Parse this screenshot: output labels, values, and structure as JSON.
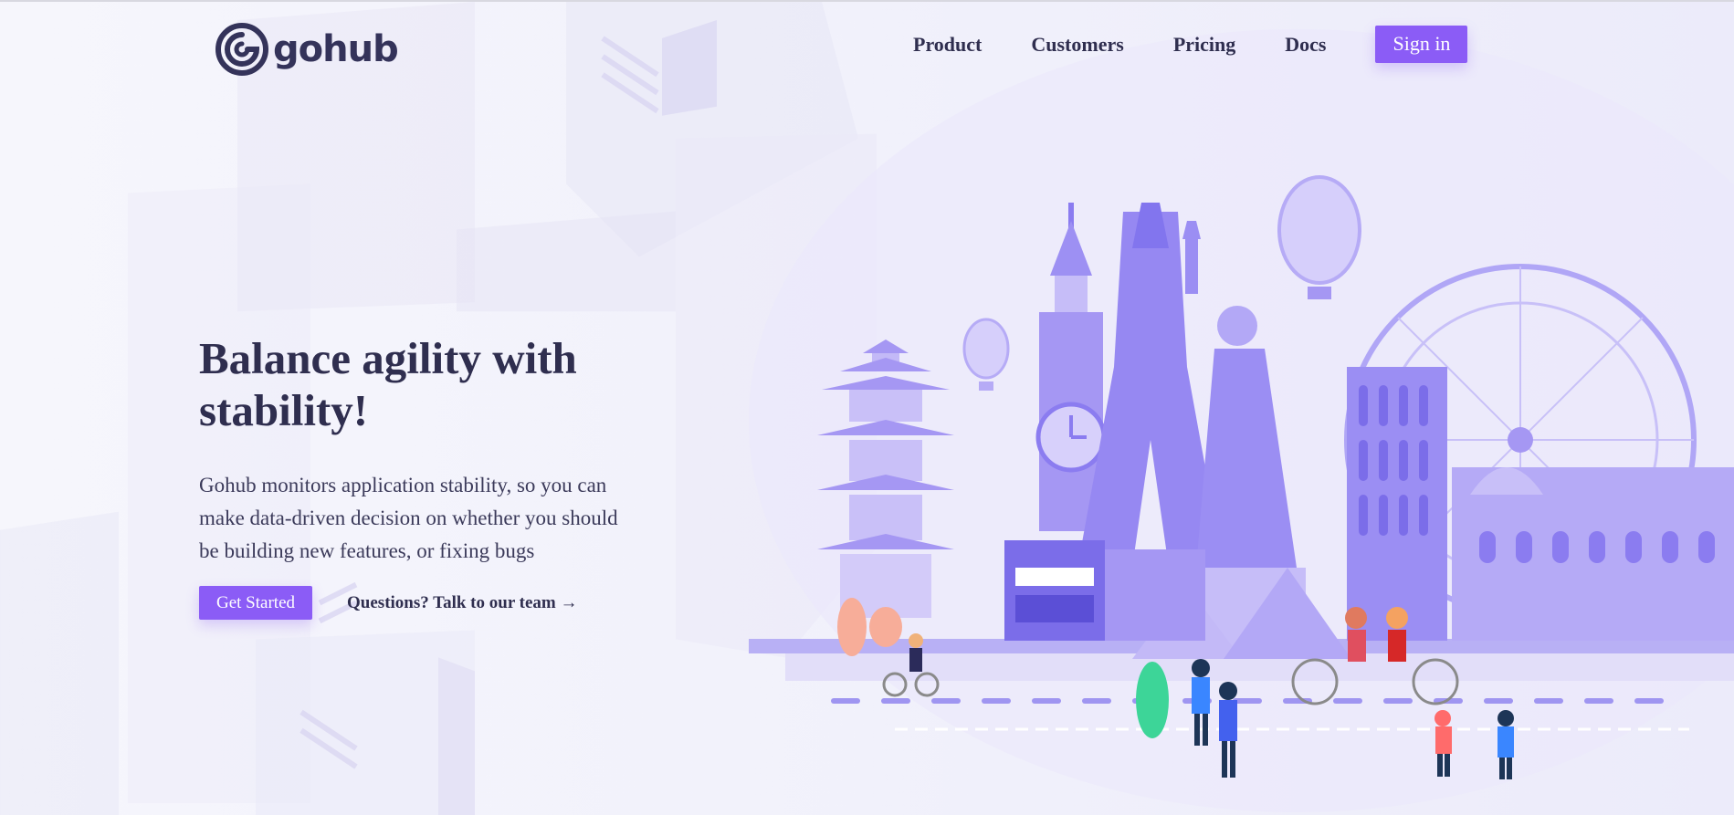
{
  "brand": {
    "name": "gohub"
  },
  "nav": {
    "items": [
      {
        "label": "Product"
      },
      {
        "label": "Customers"
      },
      {
        "label": "Pricing"
      },
      {
        "label": "Docs"
      }
    ],
    "sign_in_label": "Sign in"
  },
  "hero": {
    "title_line1": "Balance agility with",
    "title_line2": "stability!",
    "description": "Gohub monitors application stability, so you can make data-driven decision on whether you should be building new features, or fixing bugs",
    "primary_cta": "Get Started",
    "secondary_cta": "Questions? Talk to our team →"
  },
  "colors": {
    "accent": "#8b5cf6",
    "text": "#2f2e4f",
    "illustration_main": "#9b8cf5",
    "illustration_light": "#c9c3f8"
  },
  "icons": {
    "logo": "swirl-g-icon"
  }
}
